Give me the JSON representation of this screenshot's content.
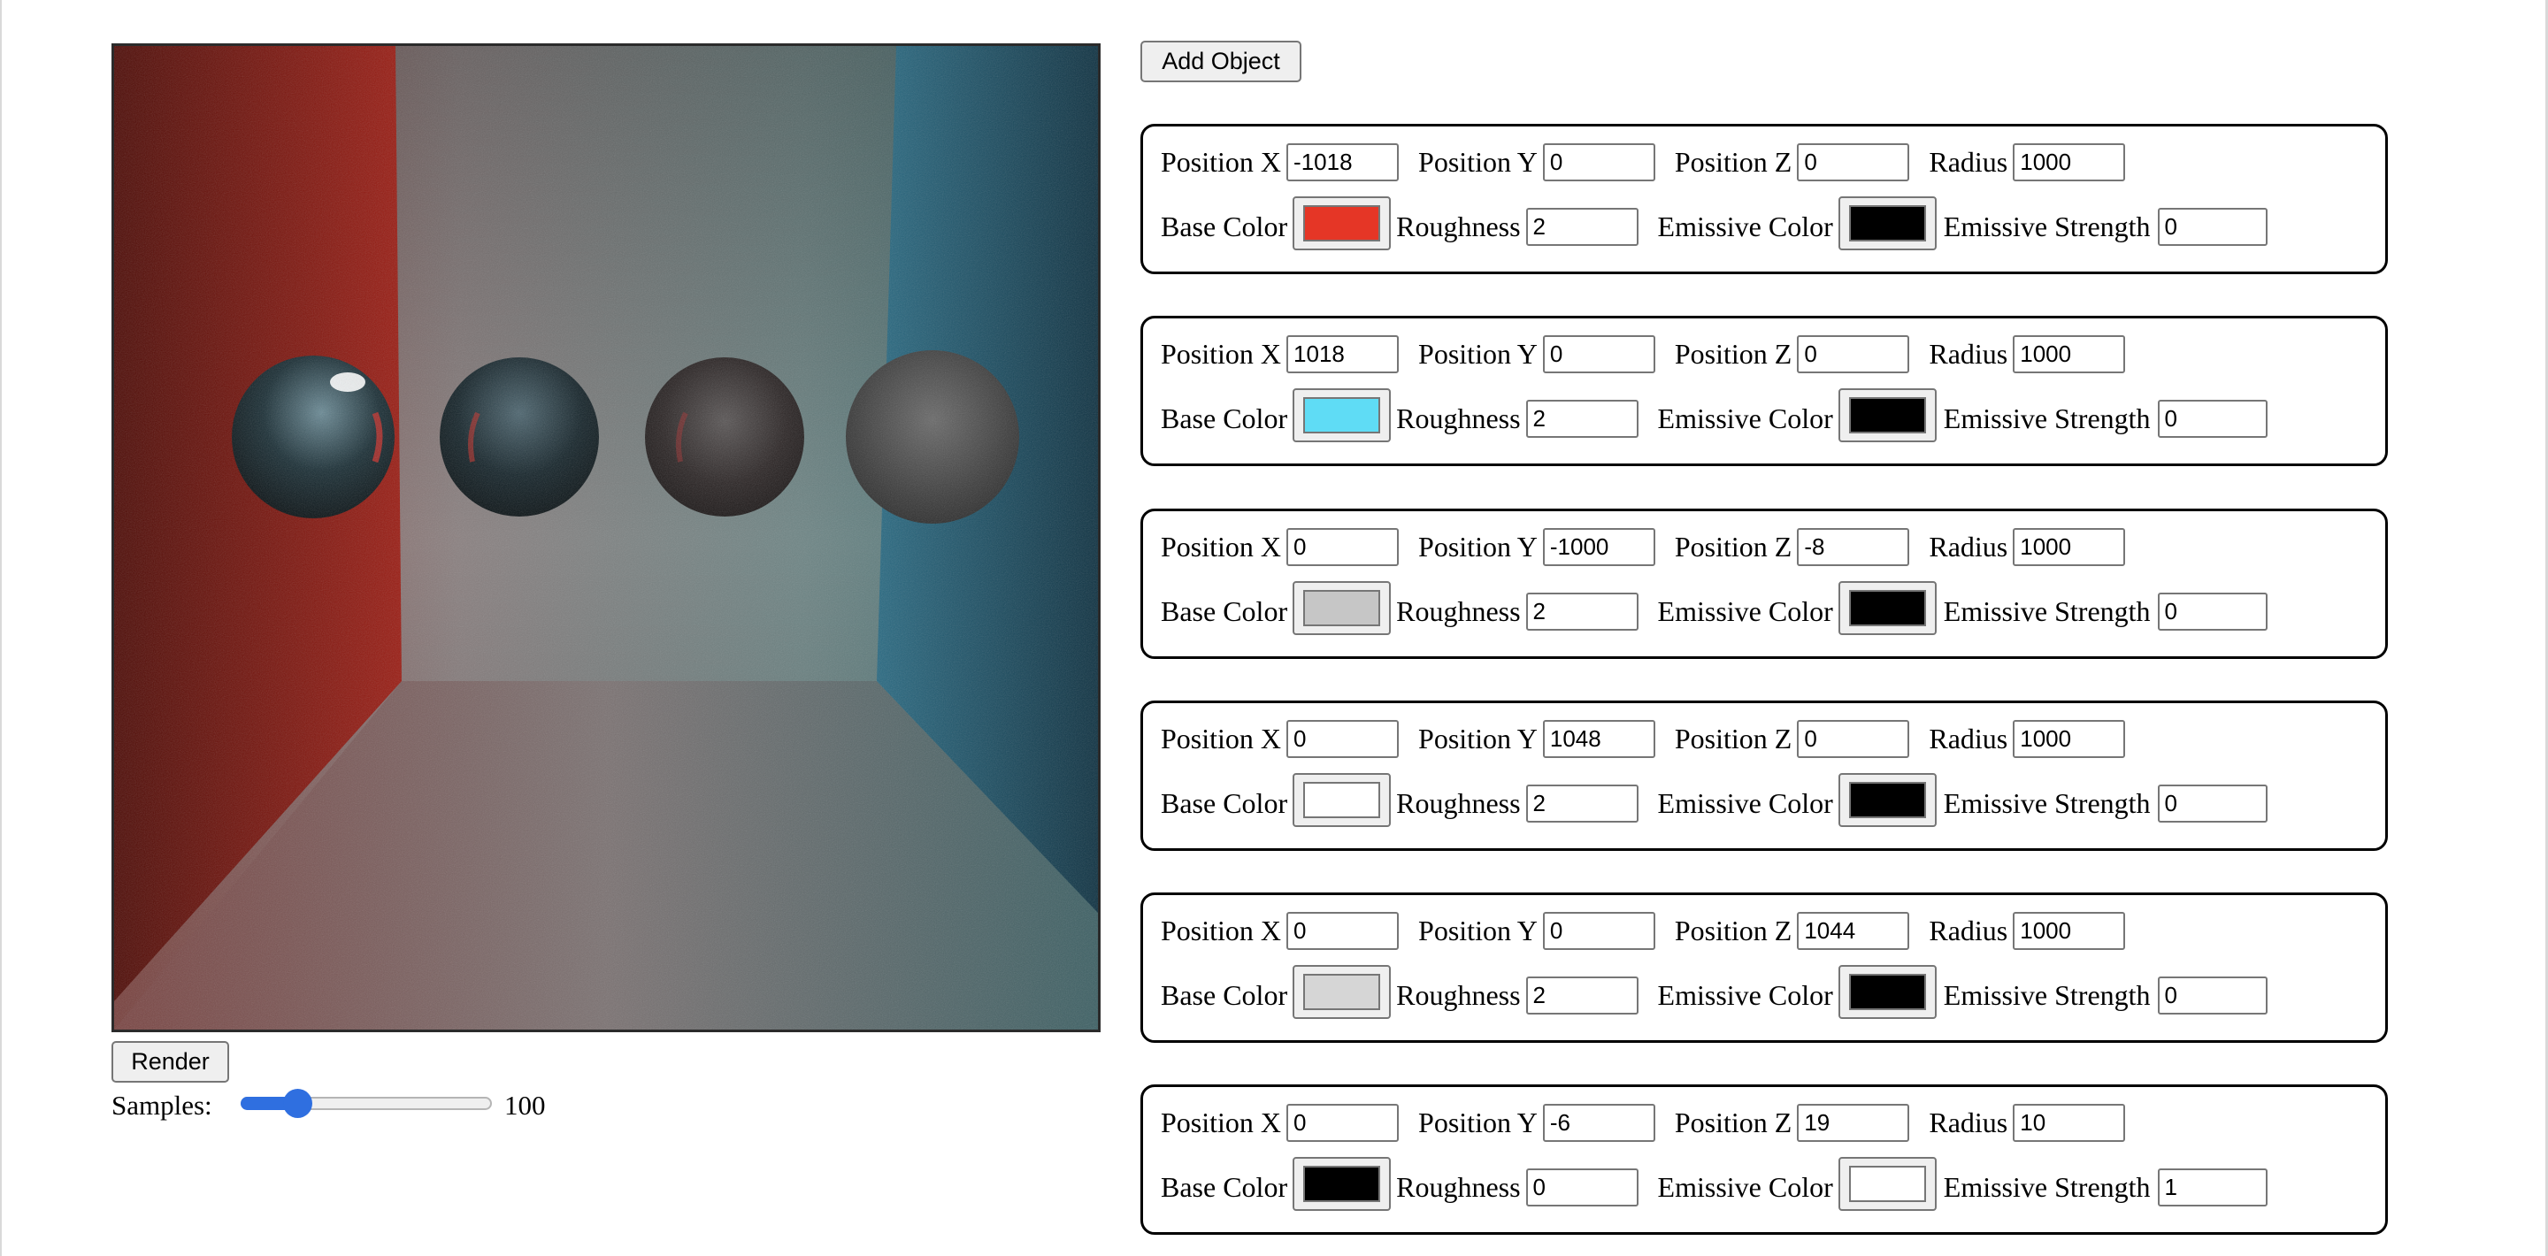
{
  "controls": {
    "add_object_label": "Add Object",
    "render_label": "Render",
    "samples_label": "Samples:",
    "samples_value": "100",
    "samples_slider_fraction": 0.1
  },
  "labels": {
    "position_x": "Position X",
    "position_y": "Position Y",
    "position_z": "Position Z",
    "radius": "Radius",
    "base_color": "Base Color",
    "roughness": "Roughness",
    "emissive_color": "Emissive Color",
    "emissive_strength": "Emissive Strength"
  },
  "objects": [
    {
      "pos_x": "-1018",
      "pos_y": "0",
      "pos_z": "0",
      "radius": "1000",
      "base_color": "#e53626",
      "roughness": "2",
      "emissive_color": "#000000",
      "emissive_strength": "0"
    },
    {
      "pos_x": "1018",
      "pos_y": "0",
      "pos_z": "0",
      "radius": "1000",
      "base_color": "#5fdcf5",
      "roughness": "2",
      "emissive_color": "#000000",
      "emissive_strength": "0"
    },
    {
      "pos_x": "0",
      "pos_y": "-1000",
      "pos_z": "-8",
      "radius": "1000",
      "base_color": "#c6c6c6",
      "roughness": "2",
      "emissive_color": "#000000",
      "emissive_strength": "0"
    },
    {
      "pos_x": "0",
      "pos_y": "1048",
      "pos_z": "0",
      "radius": "1000",
      "base_color": "#ffffff",
      "roughness": "2",
      "emissive_color": "#000000",
      "emissive_strength": "0"
    },
    {
      "pos_x": "0",
      "pos_y": "0",
      "pos_z": "1044",
      "radius": "1000",
      "base_color": "#d6d6d6",
      "roughness": "2",
      "emissive_color": "#000000",
      "emissive_strength": "0"
    },
    {
      "pos_x": "0",
      "pos_y": "-6",
      "pos_z": "19",
      "radius": "10",
      "base_color": "#000000",
      "roughness": "0",
      "emissive_color": "#ffffff",
      "emissive_strength": "1"
    }
  ],
  "scene_colors": {
    "left_wall": "#8a1a12",
    "right_wall": "#1b4d63",
    "back_wall": "#7a7a7a",
    "floor": "#6a6a6a",
    "accent_blue": "#2f6fe0"
  }
}
